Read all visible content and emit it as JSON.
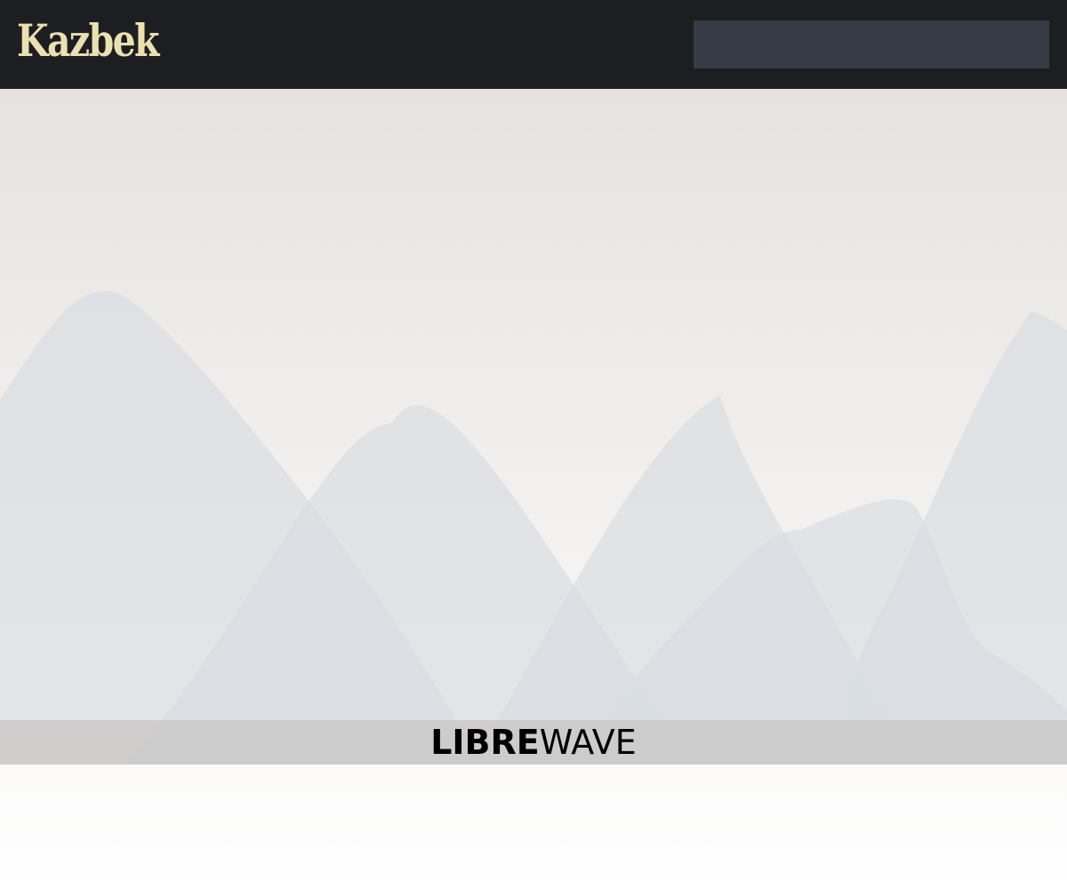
{
  "header": {
    "logo_text": "Kazbek",
    "search": {
      "value": "",
      "placeholder": ""
    }
  },
  "brand": {
    "strong": "LIBRE",
    "light": "WAVE"
  },
  "colors": {
    "header_bg": "#1c1e22",
    "logo": "#ece0b0",
    "search_bg": "#363c45",
    "sky_top": "#e6e2df",
    "mountain": "#d8dde1",
    "band": "#cdcbc9"
  }
}
